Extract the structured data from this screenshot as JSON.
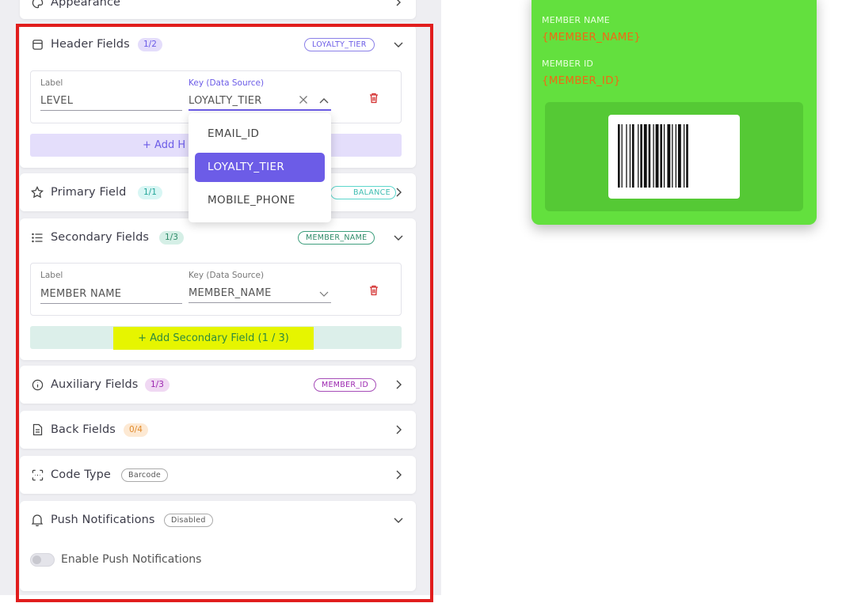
{
  "appearance": {
    "title": "Appearance"
  },
  "header_fields": {
    "title": "Header Fields",
    "count": "1/2",
    "key_badge": "LOYALTY_TIER",
    "label_caption": "Label",
    "label_value": "LEVEL",
    "key_caption": "Key (Data Source)",
    "key_value": "LOYALTY_TIER",
    "add_label": "+  Add H"
  },
  "dropdown": {
    "options": [
      "EMAIL_ID",
      "LOYALTY_TIER",
      "MOBILE_PHONE"
    ],
    "selected": "LOYALTY_TIER"
  },
  "primary_field": {
    "title": "Primary Field",
    "count": "1/1",
    "key_badge": "BALANCE"
  },
  "secondary_fields": {
    "title": "Secondary Fields",
    "count": "1/3",
    "key_badge": "MEMBER_NAME",
    "label_caption": "Label",
    "label_value": "MEMBER NAME",
    "key_caption": "Key (Data Source)",
    "key_value": "MEMBER_NAME",
    "add_label": "+  Add Secondary Field (1 / 3)"
  },
  "auxiliary_fields": {
    "title": "Auxiliary Fields",
    "count": "1/3",
    "key_badge": "MEMBER_ID"
  },
  "back_fields": {
    "title": "Back Fields",
    "count": "0/4"
  },
  "code_type": {
    "title": "Code Type",
    "badge": "Barcode"
  },
  "push_notifications": {
    "title": "Push Notifications",
    "badge": "Disabled",
    "toggle_label": "Enable Push Notifications",
    "enabled": false
  },
  "pass_preview": {
    "member_name_label": "MEMBER NAME",
    "member_name_value": "{MEMBER_NAME}",
    "member_id_label": "MEMBER ID",
    "member_id_value": "{MEMBER_ID}",
    "background_color": "#63e03e",
    "value_color": "#f06a14"
  },
  "colors": {
    "accent": "#6c5ce7",
    "highlight": "#e6f500",
    "frame": "#e11d1d"
  }
}
